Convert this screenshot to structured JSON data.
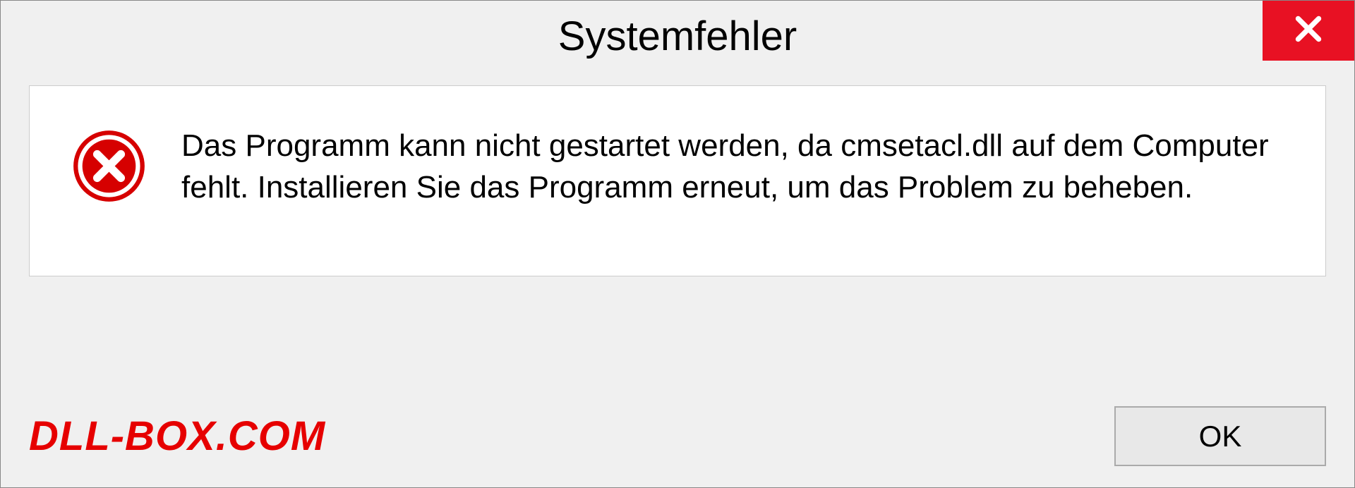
{
  "dialog": {
    "title": "Systemfehler",
    "message": "Das Programm kann nicht gestartet werden, da cmsetacl.dll auf dem Computer fehlt. Installieren Sie das Programm erneut, um das Problem zu beheben.",
    "ok_label": "OK"
  },
  "watermark": "DLL-BOX.COM",
  "colors": {
    "close_button": "#e81123",
    "error_icon": "#d60000",
    "watermark": "#e60000"
  }
}
